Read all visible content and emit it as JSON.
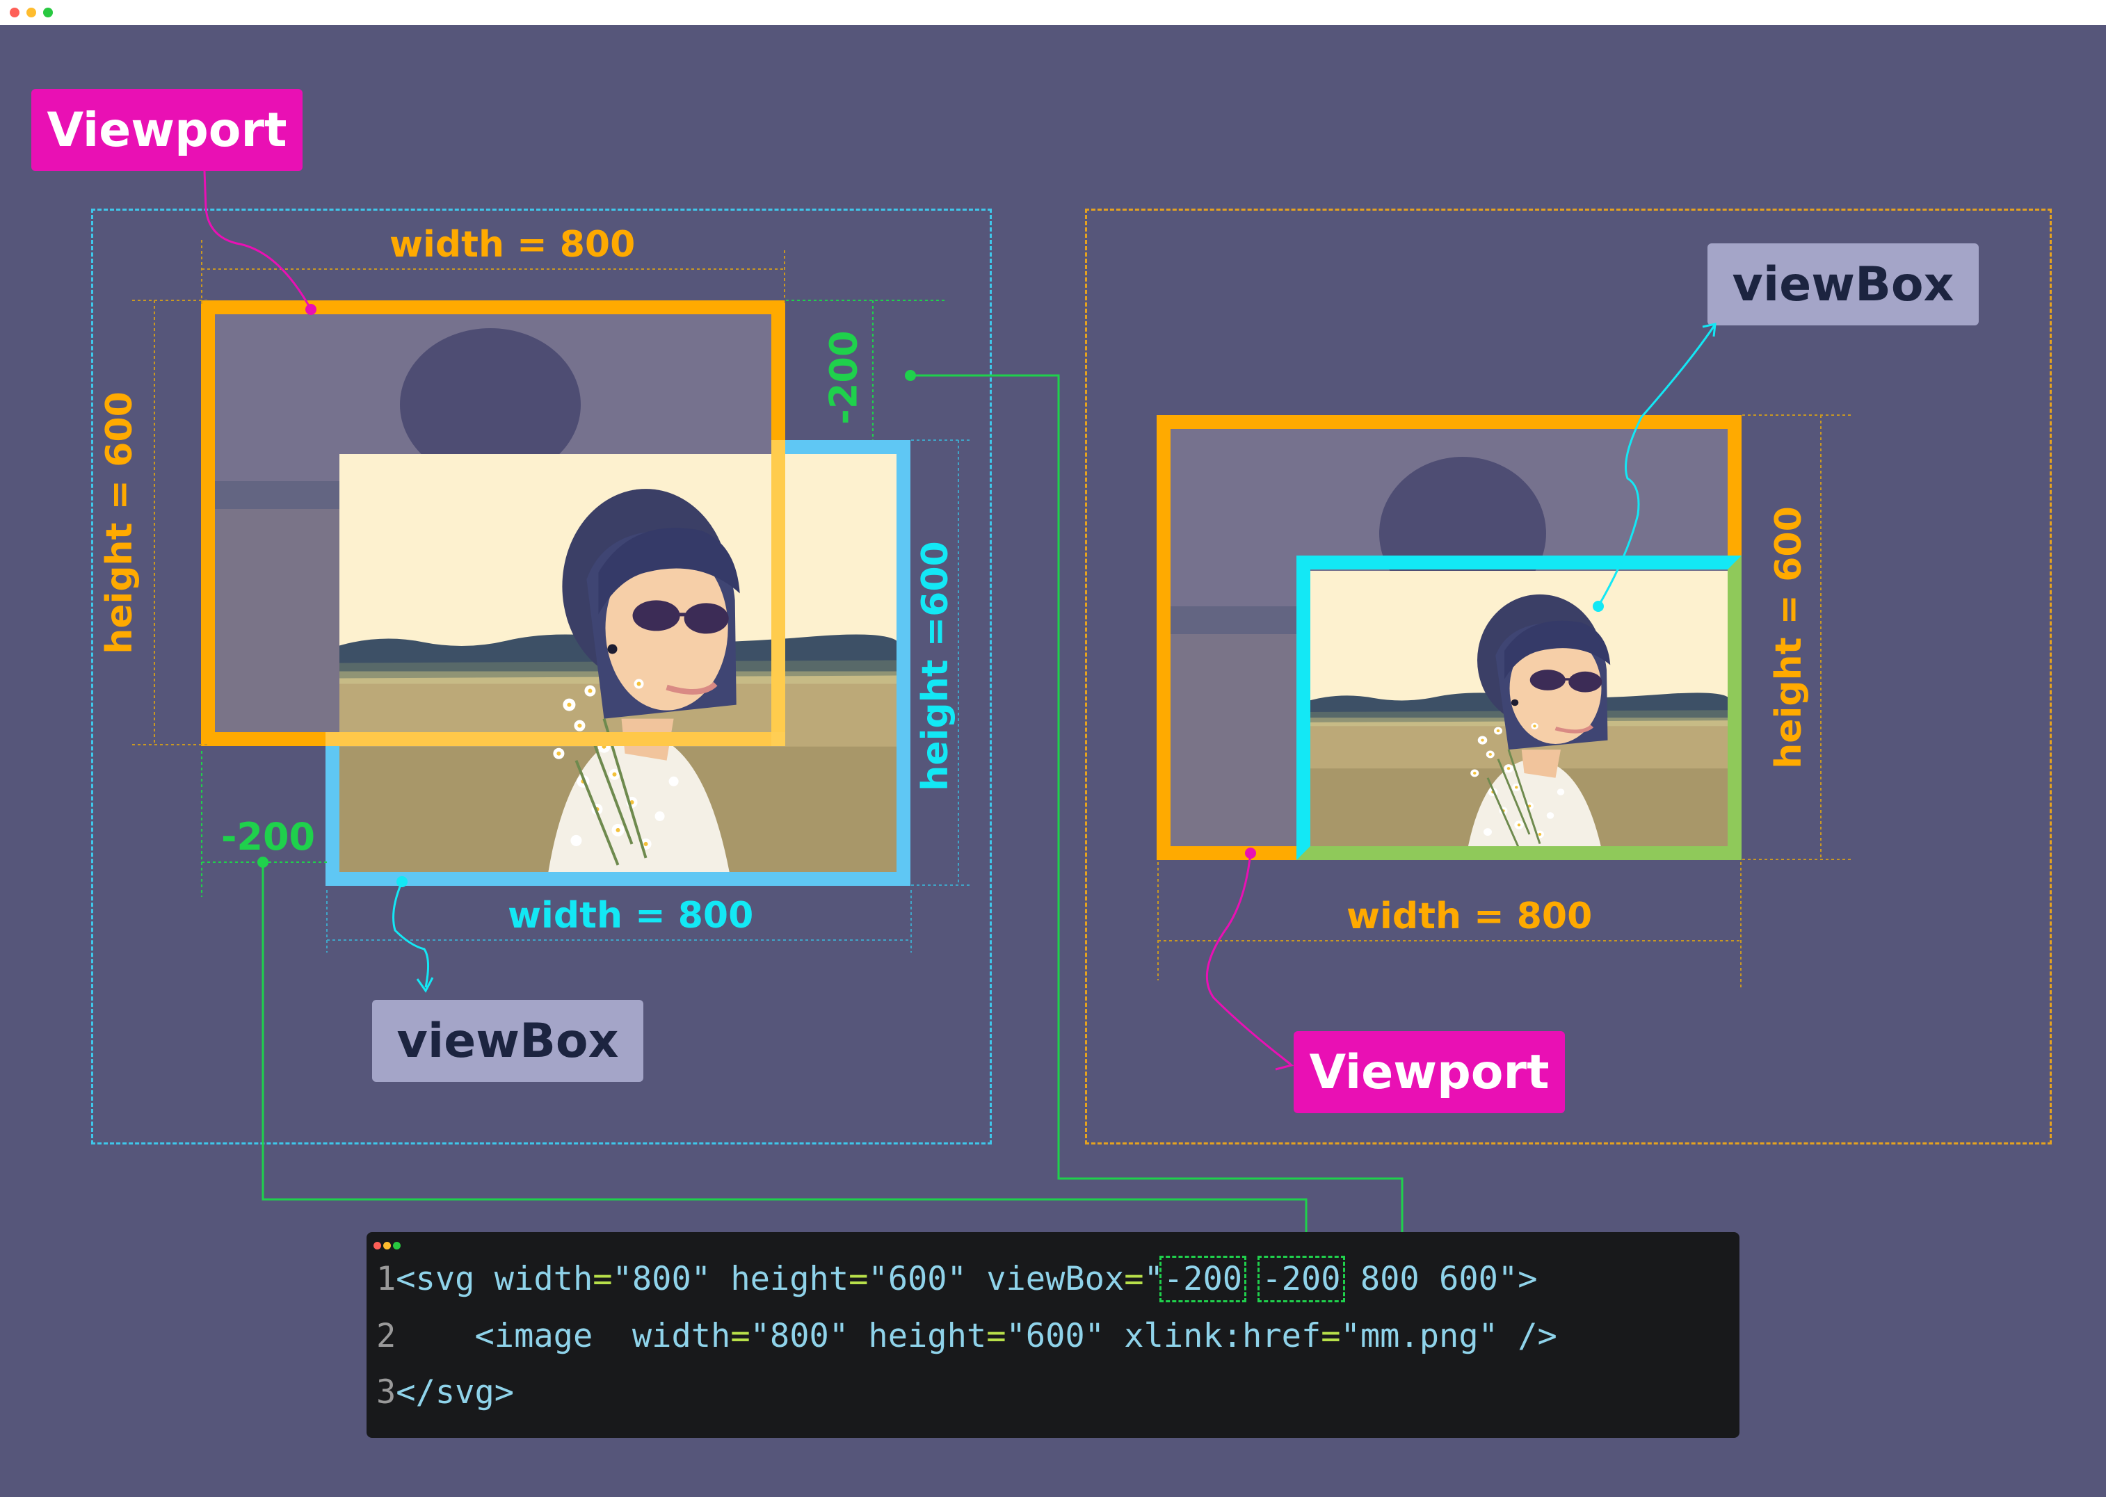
{
  "colors": {
    "background": "#56567a",
    "viewport": "#ffaa00",
    "viewbox_left": "#5fc7f4",
    "viewbox_right": "#13e8f5",
    "offset_green": "#1fd14c",
    "viewport_tag": "#e910b4",
    "viewbox_tag": "#a4a5c8"
  },
  "left": {
    "viewport_tag": "Viewport",
    "viewbox_tag": "viewBox",
    "viewport_width": "width = 800",
    "viewport_height": "height = 600",
    "viewbox_width": "width = 800",
    "viewbox_height": "height =600",
    "offset_x": "-200",
    "offset_y": "-200"
  },
  "right": {
    "viewport_tag": "Viewport",
    "viewbox_tag": "viewBox",
    "viewport_width": "width = 800",
    "viewport_height": "height = 600"
  },
  "code": {
    "lines": [
      {
        "num": "1",
        "tokens": [
          {
            "t": "<svg ",
            "c": "st"
          },
          {
            "t": "width",
            "c": "st"
          },
          {
            "t": "=",
            "c": "pn"
          },
          {
            "t": "\"800\" ",
            "c": "st"
          },
          {
            "t": "height",
            "c": "st"
          },
          {
            "t": "=",
            "c": "pn"
          },
          {
            "t": "\"600\" ",
            "c": "st"
          },
          {
            "t": "viewBox",
            "c": "st"
          },
          {
            "t": "=",
            "c": "pn"
          },
          {
            "t": "\"",
            "c": "st"
          },
          {
            "t": "-200",
            "c": "st",
            "hl": true
          },
          {
            "t": " ",
            "c": "st"
          },
          {
            "t": "-200",
            "c": "st",
            "hl": true
          },
          {
            "t": " 800 600\">",
            "c": "st"
          }
        ]
      },
      {
        "num": "2",
        "tokens": [
          {
            "t": "    <image  ",
            "c": "st"
          },
          {
            "t": "width",
            "c": "st"
          },
          {
            "t": "=",
            "c": "pn"
          },
          {
            "t": "\"800\" ",
            "c": "st"
          },
          {
            "t": "height",
            "c": "st"
          },
          {
            "t": "=",
            "c": "pn"
          },
          {
            "t": "\"600\" ",
            "c": "st"
          },
          {
            "t": "xlink:href",
            "c": "st"
          },
          {
            "t": "=",
            "c": "pn"
          },
          {
            "t": "\"mm.png\" />",
            "c": "st"
          }
        ]
      },
      {
        "num": "3",
        "tokens": [
          {
            "t": "</svg>",
            "c": "st"
          }
        ]
      }
    ]
  }
}
